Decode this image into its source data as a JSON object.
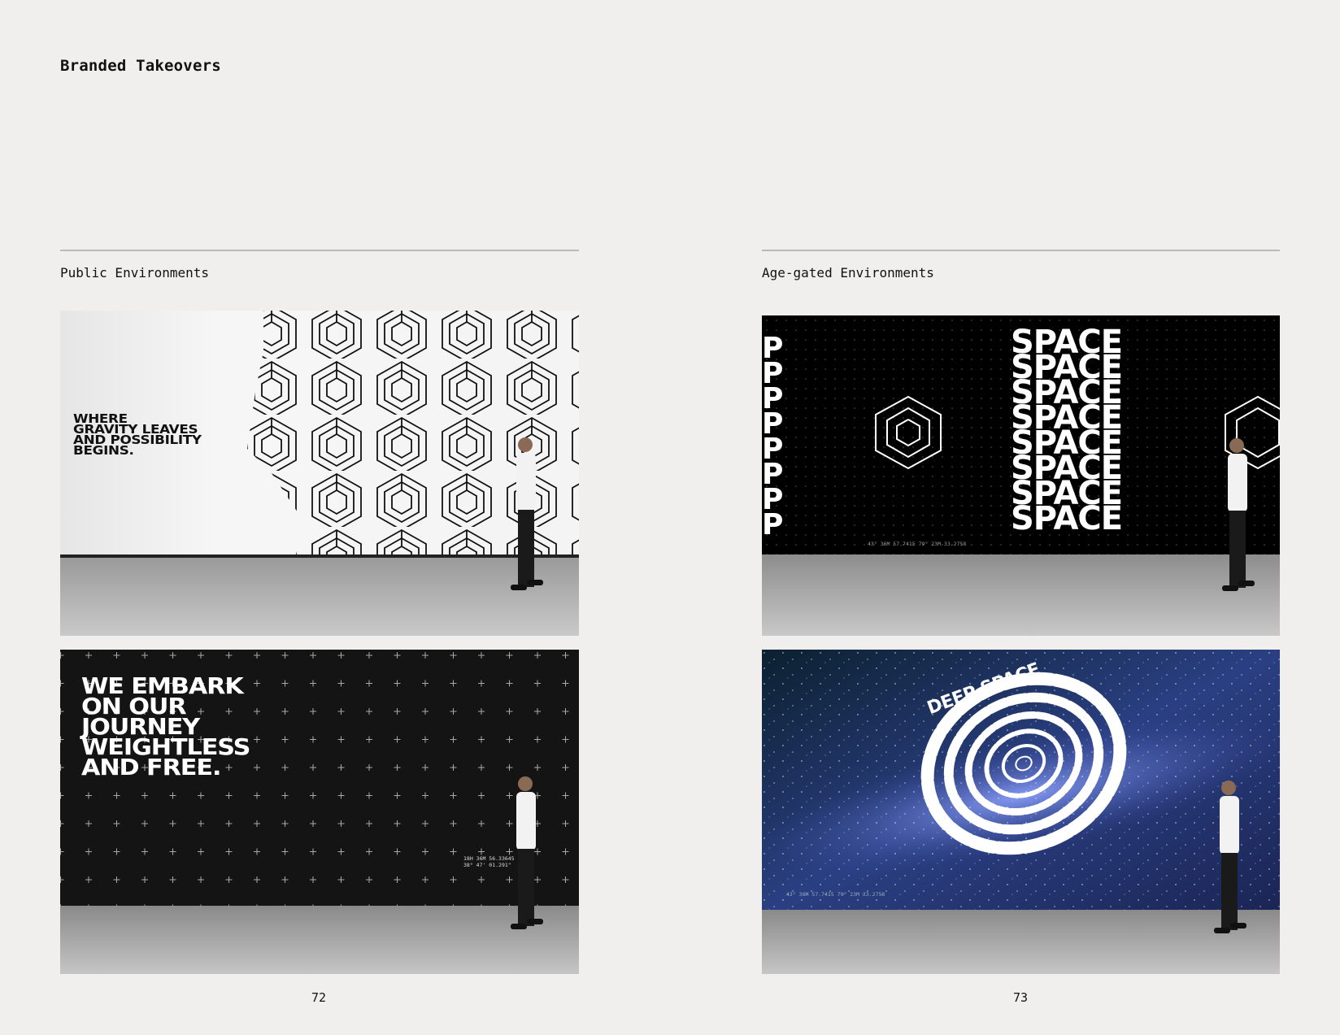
{
  "page": {
    "title": "Branded Takeovers"
  },
  "sections": [
    {
      "label": "Public Environments",
      "page_number": "72",
      "mockups": [
        {
          "wall_text": "WHERE\nGRAVITY LEAVES\nAND POSSIBILITY\nBEGINS."
        },
        {
          "wall_text": "WE EMBARK\nON OUR\nJOURNEY\nWEIGHTLESS\nAND FREE.",
          "coordinates": "18H 36M 56.33645\n38° 47' 01.291\""
        }
      ]
    },
    {
      "label": "Age-gated Environments",
      "page_number": "73",
      "mockups": [
        {
          "wall_word": "SPACE",
          "coordinates": "43° 36M 57.7415  79° 23M 33.2758"
        },
        {
          "spiral_text": "DEEP SPACE",
          "coordinates": "43° 36M 57.7415  79° 23M 33.2758"
        }
      ]
    }
  ]
}
